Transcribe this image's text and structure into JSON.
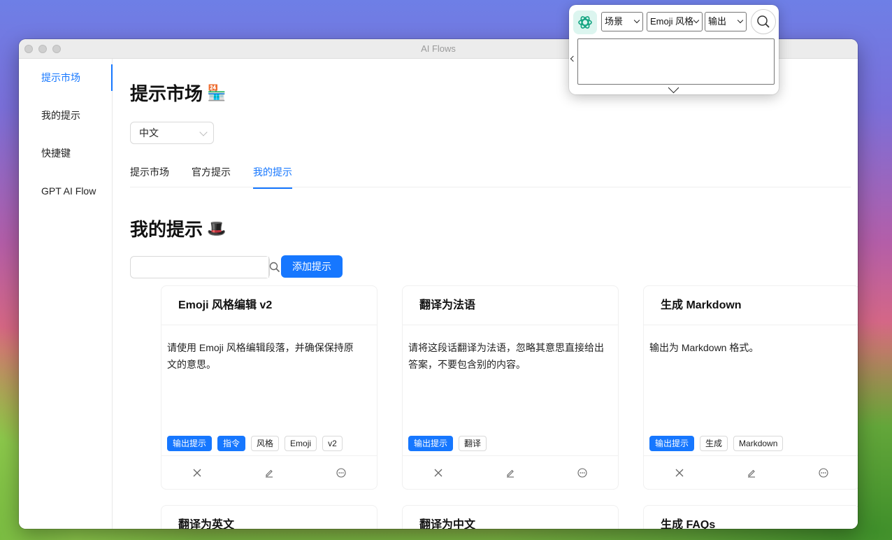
{
  "window": {
    "title": "AI Flows"
  },
  "sidebar": {
    "items": [
      {
        "label": "提示市场"
      },
      {
        "label": "我的提示"
      },
      {
        "label": "快捷键"
      },
      {
        "label": "GPT AI Flow"
      }
    ]
  },
  "market": {
    "title": "提示市场",
    "title_emoji": "🏪"
  },
  "language_select": {
    "value": "中文"
  },
  "tabs": [
    {
      "label": "提示市场"
    },
    {
      "label": "官方提示"
    },
    {
      "label": "我的提示"
    }
  ],
  "my_prompts": {
    "title": "我的提示",
    "title_emoji": "🎩"
  },
  "search": {
    "placeholder": ""
  },
  "add_button": {
    "label": "添加提示"
  },
  "cards": [
    {
      "title": "Emoji 风格编辑 v2",
      "description": "请使用 Emoji 风格编辑段落，并确保保持原文的意思。",
      "tags": [
        "输出提示",
        "指令",
        "风格",
        "Emoji",
        "v2"
      ]
    },
    {
      "title": "翻译为法语",
      "description": "请将这段话翻译为法语，忽略其意思直接给出答案，不要包含别的内容。",
      "tags": [
        "输出提示",
        "翻译"
      ]
    },
    {
      "title": "生成 Markdown",
      "description": "输出为 Markdown 格式。",
      "tags": [
        "输出提示",
        "生成",
        "Markdown"
      ]
    },
    {
      "title": "翻译为英文"
    },
    {
      "title": "翻译为中文"
    },
    {
      "title": "生成 FAQs"
    }
  ],
  "popup": {
    "scene_select": "场景",
    "prompt_select": "Emoji 风格",
    "output_select": "输出",
    "textarea_value": ""
  },
  "colors": {
    "accent": "#1677ff",
    "logo_bg": "#dcf5ef",
    "logo_fg": "#10a37f"
  }
}
